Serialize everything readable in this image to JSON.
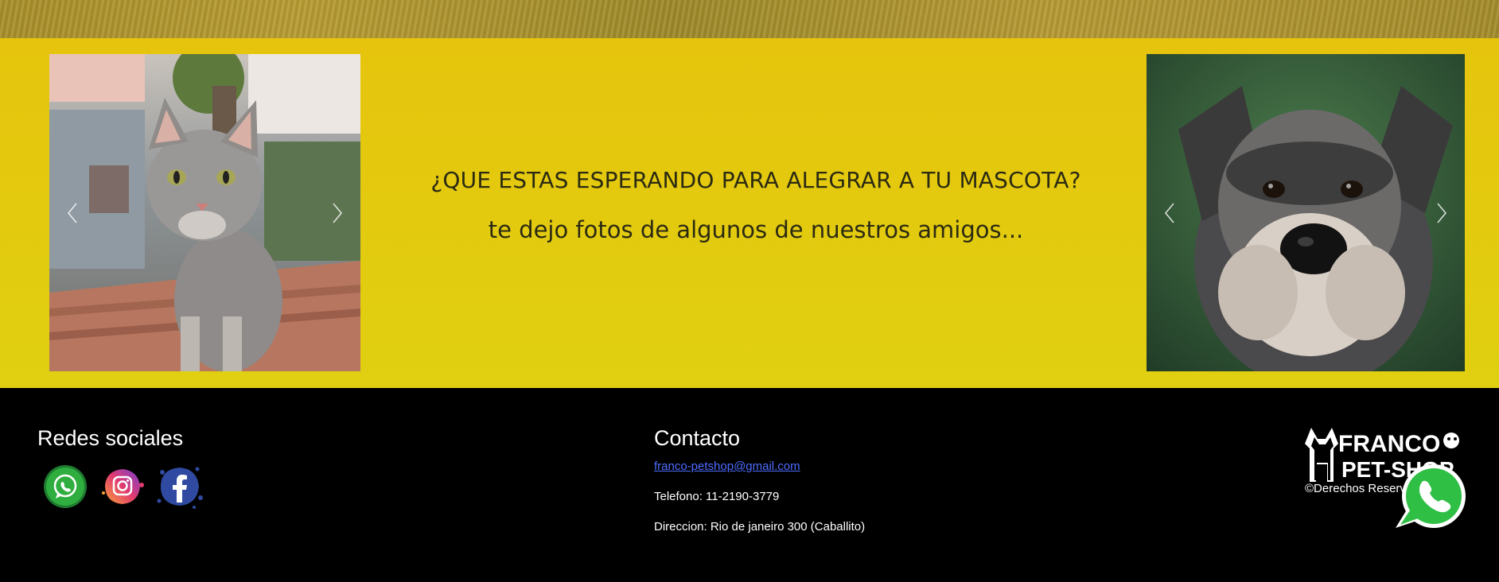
{
  "colors": {
    "band_yellow": "#e3c90f",
    "footer_bg": "#000000",
    "link_blue": "#4d6cff",
    "whatsapp_green": "#25d366"
  },
  "promo": {
    "headline": "¿QUE ESTAS ESPERANDO PARA ALEGRAR A TU MASCOTA?",
    "subline": "te dejo fotos de algunos de nuestros amigos..."
  },
  "carousels": [
    {
      "subject": "gray cat on wooden table",
      "prev_icon": "chevron-left-icon",
      "next_icon": "chevron-right-icon"
    },
    {
      "subject": "schnauzer dog portrait",
      "prev_icon": "chevron-left-icon",
      "next_icon": "chevron-right-icon"
    }
  ],
  "footer": {
    "social": {
      "title": "Redes sociales",
      "icons": [
        "whatsapp-icon",
        "instagram-icon",
        "facebook-icon"
      ]
    },
    "contact": {
      "title": "Contacto",
      "email": "franco-petshop@gmail.com",
      "phone": "Telefono: 11-2190-3779",
      "address": "Direccion: Rio de janeiro 300 (Caballito)"
    },
    "brand": {
      "logo_line1": "FRANCO",
      "logo_line2": "PET-SHOP",
      "copyright": "©Derechos Reservados"
    }
  },
  "floating_button": {
    "icon": "whatsapp-icon"
  }
}
